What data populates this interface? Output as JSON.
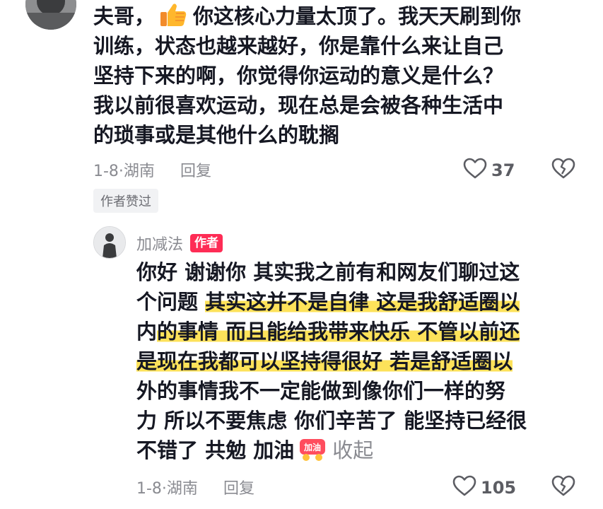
{
  "comment": {
    "lines": [
      "你这核心力量太顶了。我天天刷到你",
      "训练，状态也越来越好，你是靠什么来让自己",
      "坚持下来的啊，你觉得你运动的意义是什么？",
      "我以前很喜欢运动，现在总是会被各种生活中",
      "的琐事或是其他什么的耽搁"
    ],
    "prefix": "夫哥，",
    "sticker_icon": "thumbs-up-emoji",
    "date_location": "1-8·湖南",
    "reply_label": "回复",
    "like_count": "37",
    "author_liked": "作者赞过"
  },
  "reply": {
    "author_name": "加减法",
    "author_badge": "作者",
    "line1": "你好 谢谢你 其实我之前有和网友们聊过这",
    "line2_plain": "个问题 ",
    "line2_hl": "其实这并不是自律 这是我舒适圈以",
    "line3_plain": "内",
    "line3_hl": "的事情 而且能给我带来快乐 不管以前还",
    "line4_hl": "是现在我都可以坚持得很好 若是舒适圈以",
    "line5": "外的事情我不一定能做到像你们一样的努",
    "line6": "力 所以不要焦虑 你们辛苦了 能坚持已经很",
    "line7": "不错了 共勉 加油",
    "sticker_text": "加油",
    "sticker_icon": "jiayou-sticker",
    "collapse_label": "收起",
    "date_location": "1-8·湖南",
    "reply_label": "回复",
    "like_count": "105"
  },
  "colors": {
    "highlight": "#fde25a",
    "author_badge": "#fe2c55",
    "meta_text": "#8a8b91"
  }
}
